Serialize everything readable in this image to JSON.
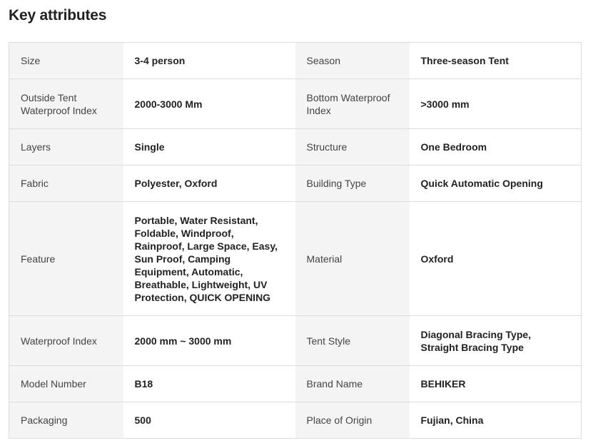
{
  "title": "Key attributes",
  "rows": [
    {
      "k1": "Size",
      "v1": "3-4 person",
      "k2": "Season",
      "v2": "Three-season Tent"
    },
    {
      "k1": "Outside Tent Waterproof Index",
      "v1": "2000-3000 Mm",
      "k2": "Bottom Waterproof Index",
      "v2": ">3000 mm"
    },
    {
      "k1": "Layers",
      "v1": "Single",
      "k2": "Structure",
      "v2": "One Bedroom"
    },
    {
      "k1": "Fabric",
      "v1": "Polyester, Oxford",
      "k2": "Building Type",
      "v2": "Quick Automatic Opening"
    },
    {
      "k1": "Feature",
      "v1": "Portable, Water Resistant, Foldable, Windproof, Rainproof, Large Space, Easy, Sun Proof, Camping Equipment, Automatic, Breathable, Lightweight, UV Protection, QUICK OPENING",
      "k2": "Material",
      "v2": "Oxford"
    },
    {
      "k1": "Waterproof Index",
      "v1": "2000 mm ~ 3000 mm",
      "k2": "Tent Style",
      "v2": "Diagonal Bracing Type, Straight Bracing Type"
    },
    {
      "k1": "Model Number",
      "v1": "B18",
      "k2": "Brand Name",
      "v2": "BEHIKER"
    },
    {
      "k1": "Packaging",
      "v1": "500",
      "k2": "Place of Origin",
      "v2": "Fujian, China"
    }
  ]
}
